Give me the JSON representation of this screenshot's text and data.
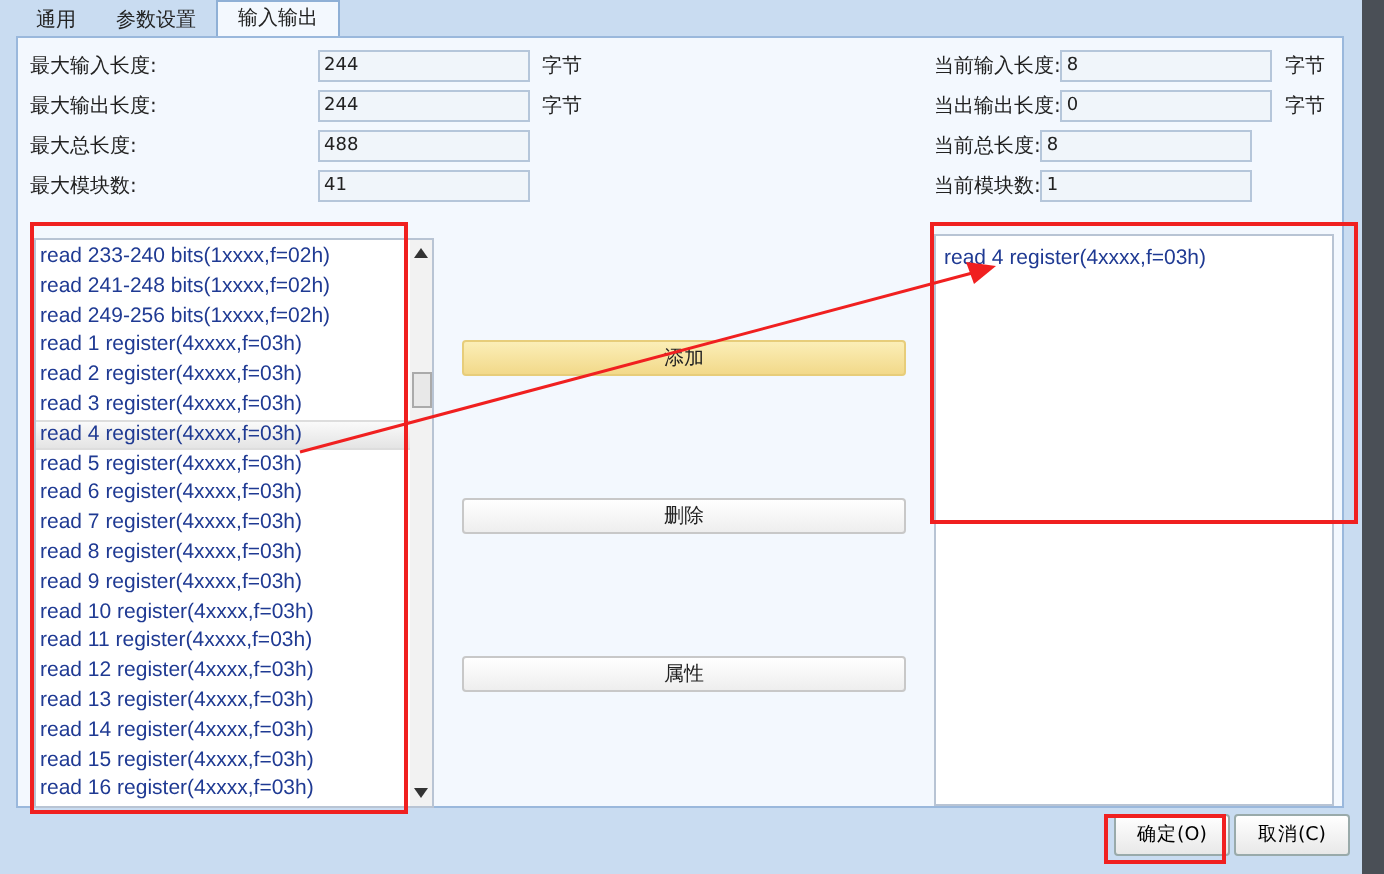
{
  "tabs": [
    {
      "label": "通用",
      "selected": false
    },
    {
      "label": "参数设置",
      "selected": false
    },
    {
      "label": "输入输出",
      "selected": true
    }
  ],
  "left_fields": [
    {
      "label": "最大输入长度:",
      "value": "244",
      "unit": "字节"
    },
    {
      "label": "最大输出长度:",
      "value": "244",
      "unit": "字节"
    },
    {
      "label": "最大总长度:",
      "value": "488"
    },
    {
      "label": "最大模块数:",
      "value": "41"
    }
  ],
  "right_fields": [
    {
      "label": "当前输入长度:",
      "value": "8",
      "unit": "字节"
    },
    {
      "label": "当出输出长度:",
      "value": "0",
      "unit": "字节"
    },
    {
      "label": "当前总长度:",
      "value": "8"
    },
    {
      "label": "当前模块数:",
      "value": "1"
    }
  ],
  "available_list": [
    {
      "text": "read 233-240 bits(1xxxx,f=02h)",
      "selected": false
    },
    {
      "text": "read 241-248 bits(1xxxx,f=02h)",
      "selected": false
    },
    {
      "text": "read 249-256 bits(1xxxx,f=02h)",
      "selected": false
    },
    {
      "text": "read 1 register(4xxxx,f=03h)",
      "selected": false
    },
    {
      "text": "read 2 register(4xxxx,f=03h)",
      "selected": false
    },
    {
      "text": "read 3 register(4xxxx,f=03h)",
      "selected": false
    },
    {
      "text": "read 4 register(4xxxx,f=03h)",
      "selected": true
    },
    {
      "text": "read 5 register(4xxxx,f=03h)",
      "selected": false
    },
    {
      "text": "read 6 register(4xxxx,f=03h)",
      "selected": false
    },
    {
      "text": "read 7 register(4xxxx,f=03h)",
      "selected": false
    },
    {
      "text": "read 8 register(4xxxx,f=03h)",
      "selected": false
    },
    {
      "text": "read 9 register(4xxxx,f=03h)",
      "selected": false
    },
    {
      "text": "read 10 register(4xxxx,f=03h)",
      "selected": false
    },
    {
      "text": "read 11 register(4xxxx,f=03h)",
      "selected": false
    },
    {
      "text": "read 12 register(4xxxx,f=03h)",
      "selected": false
    },
    {
      "text": "read 13 register(4xxxx,f=03h)",
      "selected": false
    },
    {
      "text": "read 14 register(4xxxx,f=03h)",
      "selected": false
    },
    {
      "text": "read 15 register(4xxxx,f=03h)",
      "selected": false
    },
    {
      "text": "read 16 register(4xxxx,f=03h)",
      "selected": false
    }
  ],
  "action_buttons": [
    {
      "label": "添加",
      "hovered": true
    },
    {
      "label": "删除",
      "hovered": false
    },
    {
      "label": "属性",
      "hovered": false
    }
  ],
  "selected_list": [
    {
      "text": "read 4 register(4xxxx,f=03h)"
    }
  ],
  "dialog_buttons": [
    {
      "label": "确定(O)"
    },
    {
      "label": "取消(C)"
    }
  ]
}
